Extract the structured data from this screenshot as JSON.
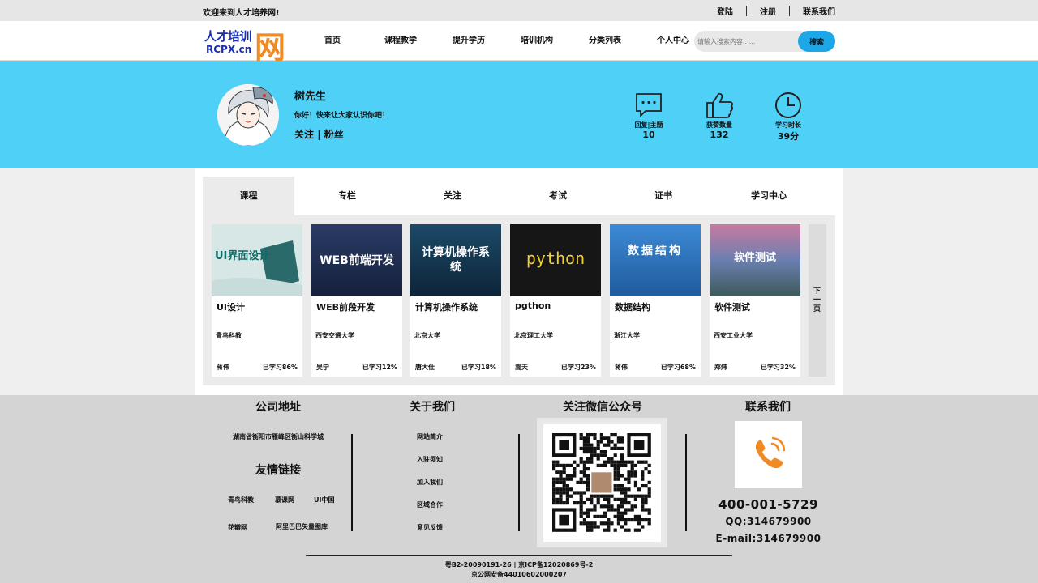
{
  "topbar": {
    "welcome": "欢迎来到人才培养网!",
    "links": [
      "登陆",
      "注册",
      "联系我们"
    ]
  },
  "header": {
    "logo_text": "人才培训",
    "logo_domain": "RCPX.cn",
    "logo_mark": "网",
    "nav": [
      "首页",
      "课程教学",
      "提升学历",
      "培训机构",
      "分类列表",
      "个人中心"
    ],
    "search_placeholder": "请输入搜索内容......",
    "search_button": "搜索"
  },
  "profile": {
    "name": "树先生",
    "intro": "你好！快来让大家认识你吧！",
    "follow": "关注",
    "fans": "粉丝",
    "stats": [
      {
        "label": "回复|主题",
        "value": "10",
        "icon": "chat-bubble-icon"
      },
      {
        "label": "获赞数量",
        "value": "132",
        "icon": "thumbs-up-icon"
      },
      {
        "label": "学习时长",
        "value": "39分",
        "icon": "clock-icon"
      }
    ]
  },
  "tabs": [
    "课程",
    "专栏",
    "关注",
    "考试",
    "证书",
    "学习中心"
  ],
  "courses": [
    {
      "title": "UI设计",
      "school": "青鸟科教",
      "teacher": "蒋伟",
      "progress": "已学习86%",
      "thumb_text": "UI界面设计",
      "thumb_color": "#d7e7e6"
    },
    {
      "title": "WEB前段开发",
      "school": "西安交通大学",
      "teacher": "吴宁",
      "progress": "已学习12%",
      "thumb_text": "WEB前端开发",
      "thumb_color": "#1d2b4d"
    },
    {
      "title": "计算机操作系统",
      "school": "北京大学",
      "teacher": "唐大仕",
      "progress": "已学习18%",
      "thumb_text": "计算机操作系统",
      "thumb_color": "#11324a"
    },
    {
      "title": "pgthon",
      "school": "北京理工大学",
      "teacher": "嵩天",
      "progress": "已学习23%",
      "thumb_text": "python",
      "thumb_color": "#1a1a1a"
    },
    {
      "title": "数据结构",
      "school": "浙江大学",
      "teacher": "蒋伟",
      "progress": "已学习68%",
      "thumb_text": "数据结构",
      "thumb_color": "#2a6cb3"
    },
    {
      "title": "软件测试",
      "school": "西安工业大学",
      "teacher": "郑炜",
      "progress": "已学习32%",
      "thumb_text": "软件测试",
      "thumb_color": "#8a7aa8"
    }
  ],
  "next_page": "下一页",
  "footer": {
    "address_title": "公司地址",
    "address": "湖南省衡阳市雁峰区衡山科学城",
    "links_title": "友情链接",
    "friend_links": [
      "青鸟科教",
      "慕课网",
      "UI中国",
      "花瓣网",
      "阿里巴巴矢量图库"
    ],
    "about_title": "关于我们",
    "about_items": [
      "网站简介",
      "入驻须知",
      "加入我们",
      "区域合作",
      "意见反馈"
    ],
    "wechat_title": "关注微信公众号",
    "contact_title": "联系我们",
    "phone": "400-001-5729",
    "qq": "QQ:314679900",
    "email": "E-mail:314679900",
    "icp": "粤B2-20090191-26 | 京ICP备12020869号-2",
    "police": "京公网安备44010602000207"
  }
}
